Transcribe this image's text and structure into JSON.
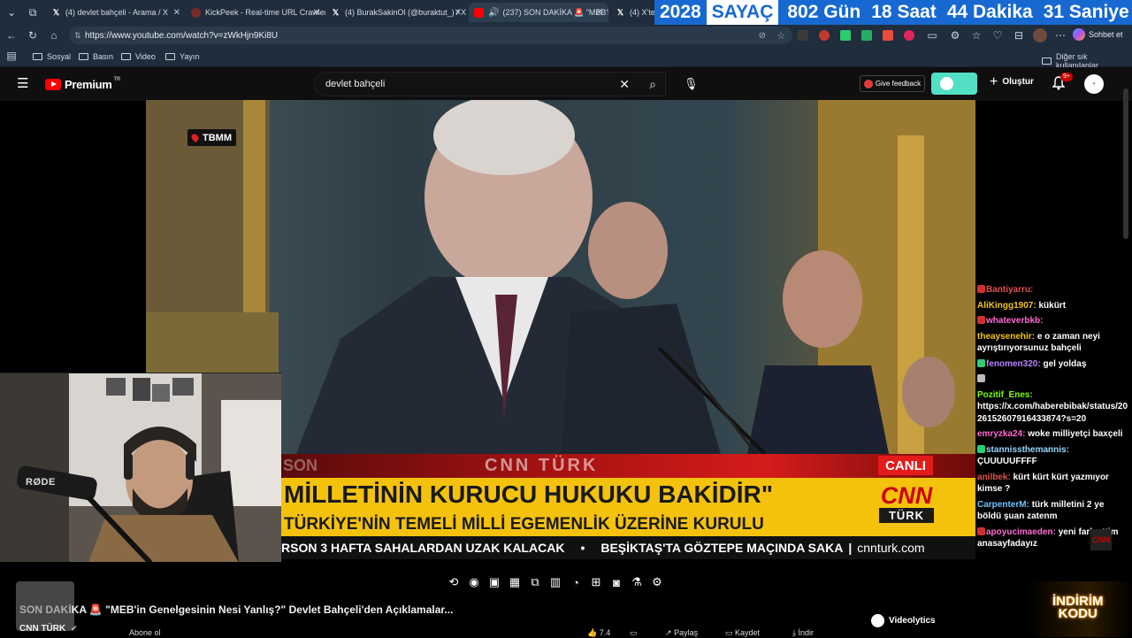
{
  "browser": {
    "tabs": [
      {
        "label": "(4) devlet bahçeli - Arama / X",
        "icon": "x-icon",
        "active": false
      },
      {
        "label": "KickPeek - Real-time URL Crawler",
        "icon": "kickpeek-icon",
        "active": false
      },
      {
        "label": "(4) BurakSakinOl (@buraktut_) / X",
        "icon": "x-icon",
        "active": false
      },
      {
        "label": "(237) SON DAKİKA 🚨 \"MEB'in",
        "icon": "youtube-icon",
        "active": true
      },
      {
        "label": "(4) X'te V",
        "icon": "x-icon",
        "active": false
      }
    ],
    "url": "https://www.youtube.com/watch?v=zWkHjn9Ki8U",
    "copilot_label": "Sohbet et",
    "bookmarks": [
      "Sosyal",
      "Basın",
      "Video",
      "Yayın"
    ],
    "other_bookmarks": "Diğer sık kullanılanlar"
  },
  "sayac": {
    "year": "2028",
    "label": "SAYAÇ",
    "days": "802 Gün",
    "hours": "18 Saat",
    "minutes": "44 Dakika",
    "seconds": "31 Saniye"
  },
  "youtube": {
    "logo_text": "Premium",
    "logo_superscript": "TR",
    "search_value": "devlet bahçeli",
    "feedback_label": "Give feedback",
    "create_label": "Oluştur",
    "notification_count": "9+"
  },
  "broadcast": {
    "location_tag": "TBMM",
    "live_label": "CANLI",
    "channel_watermark": "CNN TÜRK",
    "ghost_text": "SON",
    "headline": "MİLLETİNİN KURUCU HUKUKU BAKİDİR\"",
    "subheadline": "TÜRKİYE'NİN TEMELİ MİLLİ EGEMENLİK ÜZERİNE KURULU",
    "logo_top": "CNN",
    "logo_bottom": "TÜRK",
    "ticker_1": "RSON 3 HAFTA SAHALARDAN UZAK KALACAK",
    "ticker_2": "BEŞİKTAŞ'TA GÖZTEPE MAÇINDA SAKA",
    "ticker_site": "cnnturk.com"
  },
  "webcam": {
    "mic_brand": "RØDE"
  },
  "chat": {
    "messages": [
      {
        "user": "Bantiyarru:",
        "text": "",
        "color": "#e05252",
        "badge": "#d03030"
      },
      {
        "user": "AliKingg1907:",
        "text": "kükürt",
        "color": "#f0c419",
        "badge": ""
      },
      {
        "user": "whateverbkb:",
        "text": "",
        "color": "#ff6bd6",
        "badge": "#d03030"
      },
      {
        "user": "theaysenehir:",
        "text": "e o zaman neyi ayrıştırıyorsunuz bahçeli",
        "color": "#f0c419",
        "badge": ""
      },
      {
        "user": "fenomen320:",
        "text": "gel yoldaş",
        "color": "#b982ff",
        "badge": "#2ecc71"
      },
      {
        "user": "",
        "text": "",
        "color": "#ffffff",
        "badge": "#bbbbbb"
      },
      {
        "user": "Pozitif_Enes:",
        "text": "https://x.com/haberebibak/status/2026152607916433874?s=20",
        "color": "#7cfc00",
        "badge": ""
      },
      {
        "user": "emryzka24:",
        "text": "woke milliyetçi baxçeli",
        "color": "#ff6bd6",
        "badge": ""
      },
      {
        "user": "stannissthemannis:",
        "text": "ÇUUUUUFFFF",
        "color": "#9ad6ff",
        "badge": "#2ecc71"
      },
      {
        "user": "anilbek:",
        "text": "kürt kürt kürt yazmıyor kimse ?",
        "color": "#e05252",
        "badge": ""
      },
      {
        "user": "CarpenterM:",
        "text": "türk milletini 2 ye böldü şuan zatenm",
        "color": "#6fc3ff",
        "badge": ""
      },
      {
        "user": "apoyucimaeden:",
        "text": "yeni fark ettim anasayfadayız",
        "color": "#ff6bd6",
        "badge": "#d03030"
      }
    ],
    "mini_logo": "CNN"
  },
  "video": {
    "title_faded": "SON DAKİ",
    "title": "KA 🚨 \"MEB'in Genelgesinin Nesi Yanlış?\" Devlet Bahçeli'den Açıklamalar...",
    "channel": "CNN TÜRK",
    "subscribe_label": "Abone ol",
    "likes": "7.4",
    "share_label": "Paylaş",
    "save_label": "Kaydet",
    "download_label": "İndir",
    "videolytics_label": "Videolytics",
    "promo_line1": "İNDİRİM",
    "promo_line2": "KODU"
  }
}
